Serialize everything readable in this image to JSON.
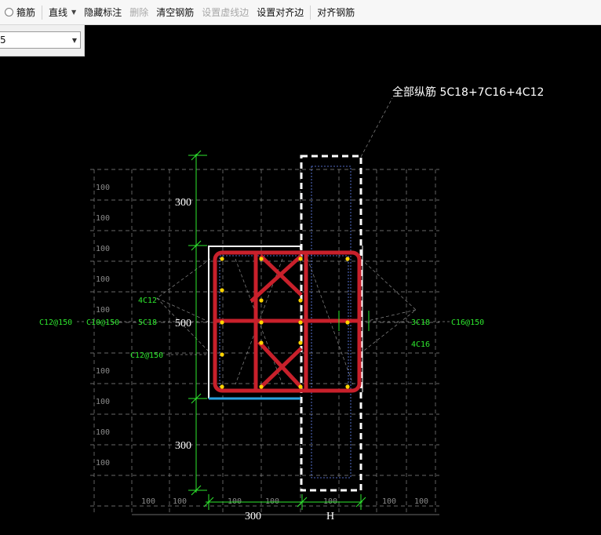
{
  "toolbar": {
    "stirrup": "箍筋",
    "line": "直线",
    "hide_annotation": "隐藏标注",
    "delete": "删除",
    "clear_rebar": "清空钢筋",
    "set_dashed_edge": "设置虚线边",
    "set_align_edge": "设置对齐边",
    "align_rebar": "对齐钢筋"
  },
  "combo": {
    "value": "5"
  },
  "drawing": {
    "rebar_label": "全部纵筋 5C18+7C16+4C12",
    "dims": {
      "top_300": "300",
      "mid_500": "500",
      "bottom_300": "300",
      "bottom_w_300": "300",
      "bottom_h": "H",
      "grid_100": "100"
    },
    "left_labels": {
      "l1": "4C12",
      "l2": "C12@150",
      "l3": "C10@150",
      "l4": "5C18",
      "l5": "C12@150"
    },
    "right_labels": {
      "r1": "3C18",
      "r2": "C16@150",
      "r3": "4C16"
    },
    "colors": {
      "rebar": "#c8202b",
      "green": "#2ee82e",
      "grid": "#8a8a8a",
      "blue": "#29a3e0",
      "background": "#000000"
    }
  }
}
